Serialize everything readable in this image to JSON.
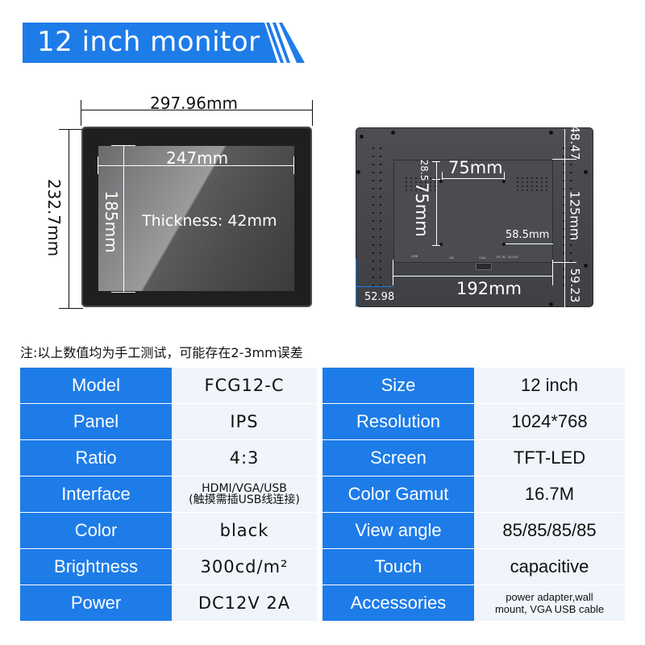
{
  "banner": {
    "title": "12 inch monitor",
    "color": "#1e7ce8"
  },
  "front_view": {
    "overall_width": "297.96mm",
    "overall_height": "232.7mm",
    "screen_width": "247mm",
    "screen_height": "185mm",
    "thickness": "Thickness: 42mm"
  },
  "back_view": {
    "vesa_horizontal": "75mm",
    "vesa_vertical": "75mm",
    "top_offset_inner": "28.5",
    "right_offset": "58.5mm",
    "bottom_width": "192mm",
    "left_offset": "52.98",
    "top_margin": "48.47",
    "middle_height": "125mm",
    "bottom_margin": "59.23",
    "port_labels": [
      "USB",
      "HD",
      "VGA",
      "PC IN",
      "DC12V"
    ]
  },
  "note": "注:以上数值均为手工测试，可能存在2-3mm误差",
  "specs": {
    "rows": [
      {
        "label1": "Model",
        "value1": "FCG12-C",
        "label2": "Size",
        "value2": "12 inch"
      },
      {
        "label1": "Panel",
        "value1": "IPS",
        "label2": "Resolution",
        "value2": "1024*768"
      },
      {
        "label1": "Ratio",
        "value1": "4:3",
        "label2": "Screen",
        "value2": "TFT-LED"
      },
      {
        "label1": "Interface",
        "value1_line1": "HDMI/VGA/USB",
        "value1_line2": "(触摸需插USB线连接)",
        "label2": "Color Gamut",
        "value2": "16.7M"
      },
      {
        "label1": "Color",
        "value1": "black",
        "label2": "View angle",
        "value2": "85/85/85/85"
      },
      {
        "label1": "Brightness",
        "value1": "300cd/m²",
        "label2": "Touch",
        "value2": "capacitive"
      },
      {
        "label1": "Power",
        "value1": "DC12V 2A",
        "label2": "Accessories",
        "value2_line1": "power adapter,wall",
        "value2_line2": "mount, VGA USB cable"
      }
    ]
  }
}
